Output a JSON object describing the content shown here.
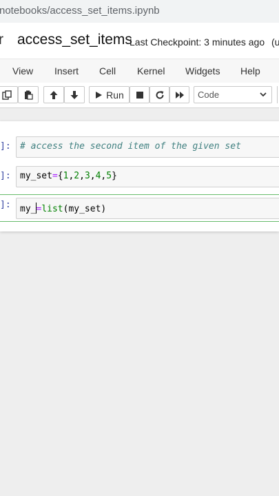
{
  "browser": {
    "url_fragment": "notebooks/access_set_items.ipynb"
  },
  "header": {
    "logo_fragment": "r",
    "notebook_name": "access_set_items",
    "checkpoint": "Last Checkpoint: 3 minutes ago",
    "status_fragment": "(un"
  },
  "menu": {
    "items": [
      "View",
      "Insert",
      "Cell",
      "Kernel",
      "Widgets",
      "Help"
    ]
  },
  "toolbar": {
    "run_label": "Run",
    "cell_type": "Code",
    "icons": [
      "copy-icon",
      "paste-icon",
      "arrow-up-icon",
      "arrow-down-icon",
      "play-icon",
      "stop-icon",
      "restart-icon",
      "fast-forward-icon",
      "chevron-down-icon"
    ]
  },
  "cells": [
    {
      "prompt": "]:",
      "code_comment": "# access the second item of the given set"
    },
    {
      "prompt": "]:",
      "code_parts": [
        "my_set",
        "=",
        "{",
        "1",
        ",",
        "2",
        ",",
        "3",
        ",",
        "4",
        ",",
        "5",
        "}"
      ]
    },
    {
      "prompt": "]:",
      "code_parts": [
        "my_",
        "=",
        "list",
        "(my_set)"
      ]
    }
  ],
  "colors": {
    "selected_border": "#66bb6a",
    "prompt": "#303f9f",
    "comment": "#408080",
    "operator": "#aa22ff",
    "number": "#008000"
  }
}
